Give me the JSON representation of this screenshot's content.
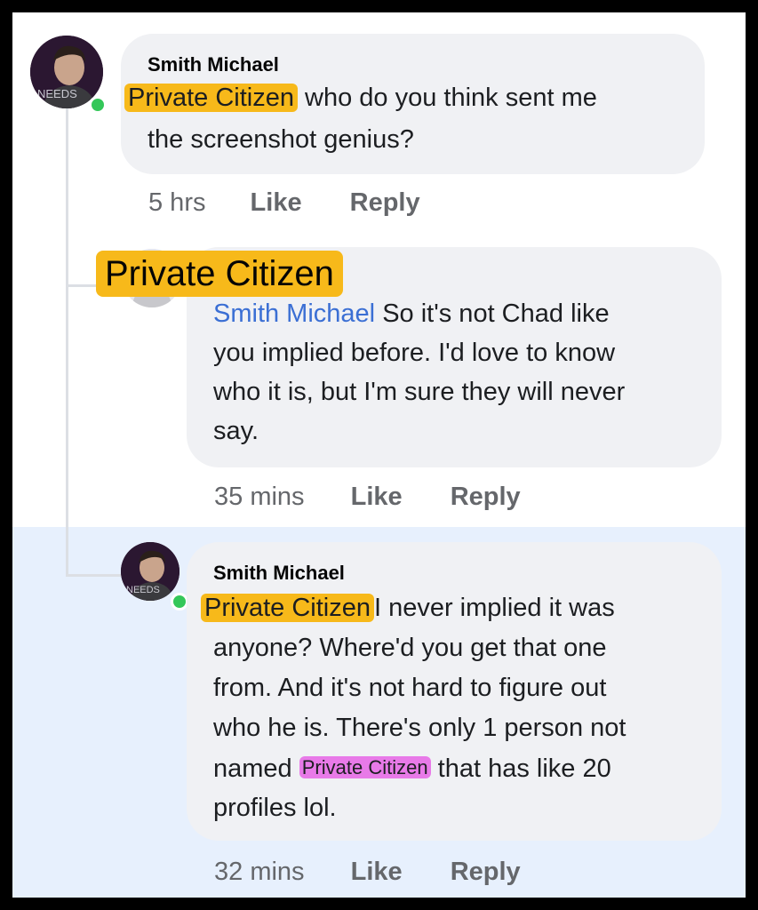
{
  "comments": [
    {
      "author": "Smith Michael",
      "tag": "Private Citizen",
      "line1_rest": "who do you think sent me",
      "line2": "the screenshot genius?",
      "time": "5 hrs",
      "like": "Like",
      "reply": "Reply",
      "avatar_overlay_text": "NEEDS"
    },
    {
      "author_tag": "Private Citizen",
      "mention": "Smith Michael",
      "line1_rest": "So it's not Chad like",
      "line2": "you implied before. I'd love to know",
      "line3": "who it is, but I'm sure they will never",
      "line4": "say.",
      "time": "35 mins",
      "like": "Like",
      "reply": "Reply"
    },
    {
      "author": "Smith Michael",
      "tag": "Private Citizen",
      "line1_rest": "I never implied it was",
      "line2": "anyone? Where'd you get that one",
      "line3": "from. And it's not hard to figure out",
      "line4": "who he is. There's only 1 person not",
      "line5_pre": "named",
      "line5_tag": "Private Citizen",
      "line5_post": "that has like 20",
      "line6": "profiles lol.",
      "time": "32 mins",
      "like": "Like",
      "reply": "Reply",
      "avatar_overlay_text": "NEEDS"
    }
  ],
  "colors": {
    "tag_highlight": "#f7b91a",
    "pink_highlight": "#e87ae8",
    "mention_blue": "#3b6fd4",
    "online_green": "#34c759",
    "selected_bg": "#e7f0fd"
  }
}
